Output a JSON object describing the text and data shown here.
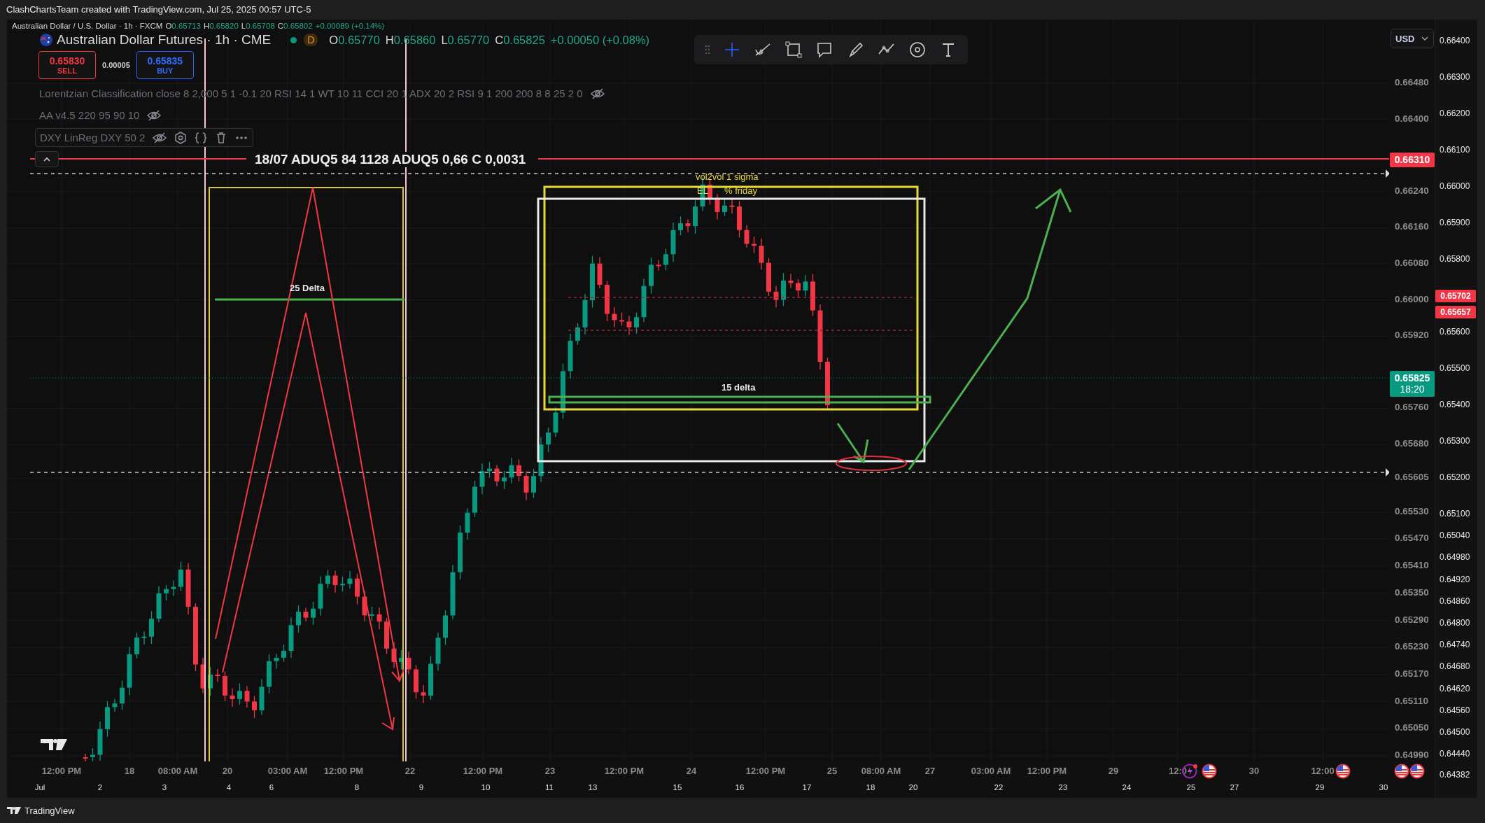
{
  "caption": "ClashChartsTeam created with TradingView.com, Jul 25, 2025 00:57 UTC-5",
  "symbol_overlay": {
    "title": "Australian Dollar / U.S. Dollar · 1h · FXCM",
    "ohlc": [
      {
        "label": "O",
        "value": "0.65713"
      },
      {
        "label": "H",
        "value": "0.65820"
      },
      {
        "label": "L",
        "value": "0.65708"
      },
      {
        "label": "C",
        "value": "0.65802"
      }
    ],
    "change": "+0.00089 (+0.14%)"
  },
  "symbol_main": {
    "title": "Australian Dollar Futures · 1h · CME",
    "status_badge": "D",
    "ohlc": [
      {
        "label": "O",
        "value": "0.65770"
      },
      {
        "label": "H",
        "value": "0.65860"
      },
      {
        "label": "L",
        "value": "0.65770"
      },
      {
        "label": "C",
        "value": "0.65825"
      }
    ],
    "change": "+0.00050 (+0.08%)"
  },
  "trade": {
    "sell_price": "0.65830",
    "sell_label": "SELL",
    "spread": "0.00005",
    "buy_price": "0.65835",
    "buy_label": "BUY"
  },
  "indicators": [
    {
      "label": "Lorentzian Classification close 8 2,000 5 1 -0.1 20 RSI 14 1 WT 10 11 CCI 20 1 ADX 20 2 RSI 9 1 200 200 8 8 25 2 0",
      "hidden": true,
      "selected": false
    },
    {
      "label": "AA v4.5 220 95 90 10",
      "hidden": true,
      "selected": false
    },
    {
      "label": "DXY LinReg DXY 50 2",
      "hidden": true,
      "selected": true
    }
  ],
  "tools": [
    {
      "kind": "crosshair",
      "selected": true
    },
    {
      "kind": "trendline",
      "selected": false
    },
    {
      "kind": "rectangle",
      "selected": false
    },
    {
      "kind": "callout",
      "selected": false
    },
    {
      "kind": "brush",
      "selected": false
    },
    {
      "kind": "path",
      "selected": false
    },
    {
      "kind": "target",
      "selected": false
    },
    {
      "kind": "text",
      "selected": false
    }
  ],
  "chart_notes": {
    "level_note": "18/07 ADUQ5 84 1128 ADUQ5 0,66 C 0,0031",
    "left_delta": "25 Delta",
    "right_delta": "15 delta",
    "sigma": "vol2vol 1 sigma",
    "el": "EL",
    "friday": "% friday"
  },
  "currency": "USD",
  "price_axis": [
    "0.66480",
    "0.66400",
    "0.66240",
    "0.66160",
    "0.66080",
    "0.66000",
    "0.65920",
    "0.65760",
    "0.65680",
    "0.65605",
    "0.65530",
    "0.65470",
    "0.65410",
    "0.65350",
    "0.65290",
    "0.65230",
    "0.65170",
    "0.65110",
    "0.65050",
    "0.64990"
  ],
  "overlay_axis": [
    "0.66400",
    "0.66300",
    "0.66200",
    "0.66100",
    "0.66000",
    "0.65900",
    "0.65800",
    "0.65600",
    "0.65500",
    "0.65400",
    "0.65300",
    "0.65200",
    "0.65100",
    "0.65040",
    "0.64980",
    "0.64920",
    "0.64860",
    "0.64800",
    "0.64740",
    "0.64680",
    "0.64620",
    "0.64560",
    "0.64500",
    "0.64440",
    "0.64382"
  ],
  "price_tags": [
    {
      "value": "0.66310",
      "color": "#f23645"
    },
    {
      "value": "0.65825",
      "time": "18:20",
      "color": "#089981"
    }
  ],
  "overlay_price_tags": [
    {
      "value": "0.65702",
      "color": "#f23645"
    },
    {
      "value": "0.65657",
      "color": "#f23645"
    }
  ],
  "time_axis": [
    "12:00 PM",
    "18",
    "08:00 AM",
    "20",
    "03:00 AM",
    "12:00 PM",
    "22",
    "12:00 PM",
    "23",
    "12:00 PM",
    "24",
    "12:00 PM",
    "25",
    "08:00 AM",
    "27",
    "03:00 AM",
    "12:00 PM",
    "29",
    "12:0",
    "30",
    "12:00"
  ],
  "overlay_time_axis": [
    "Jul",
    "2",
    "3",
    "4",
    "6",
    "8",
    "9",
    "10",
    "11",
    "13",
    "15",
    "16",
    "17",
    "18",
    "20",
    "22",
    "23",
    "24",
    "25",
    "27",
    "29",
    "30"
  ],
  "event_markers": [
    {
      "kind": "lightning"
    },
    {
      "kind": "flag"
    },
    {
      "kind": "flag"
    },
    {
      "kind": "flag"
    },
    {
      "kind": "flag"
    }
  ],
  "footer": "TradingView"
}
